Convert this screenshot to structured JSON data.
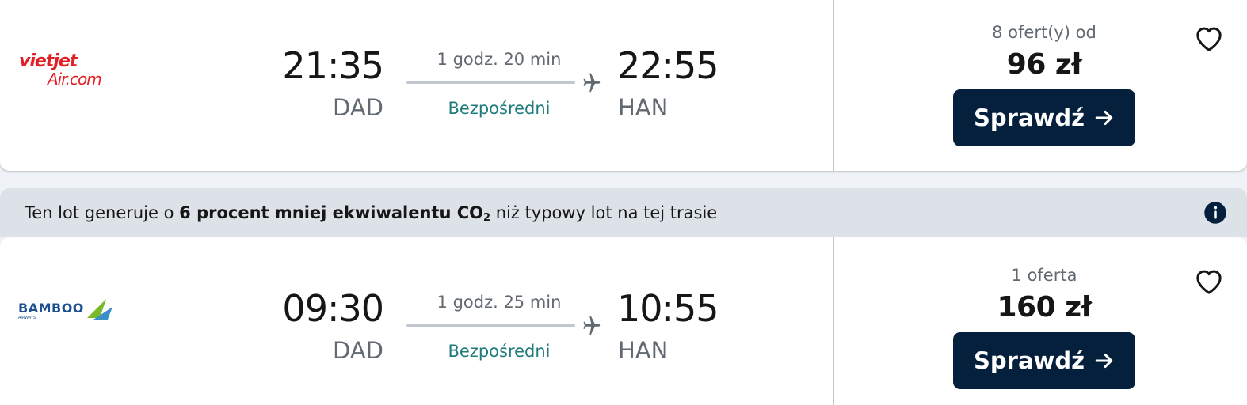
{
  "results": [
    {
      "airline": "VietJet Air",
      "logo_text_1": "vietjet",
      "logo_text_2": "Air.com",
      "dep_time": "21:35",
      "dep_code": "DAD",
      "duration": "1 godz. 20 min",
      "stops": "Bezpośredni",
      "arr_time": "22:55",
      "arr_code": "HAN",
      "offers": "8 ofert(y) od",
      "price": "96 zł",
      "button": "Sprawdź"
    },
    {
      "airline": "Bamboo Airways",
      "logo_text_1": "BAMBOO",
      "logo_text_2": "AIRWAYS",
      "dep_time": "09:30",
      "dep_code": "DAD",
      "duration": "1 godz. 25 min",
      "stops": "Bezpośredni",
      "arr_time": "10:55",
      "arr_code": "HAN",
      "offers": "1 oferta",
      "price": "160 zł",
      "button": "Sprawdź"
    }
  ],
  "eco_banner": {
    "prefix": "Ten lot generuje o ",
    "highlight": "6 procent mniej ekwiwalentu CO",
    "subscript": "2",
    "suffix": " niż typowy lot na tej trasie"
  },
  "colors": {
    "button_bg": "#05203c",
    "direct_text": "#1f7b7c",
    "vietjet_red": "#e31f26",
    "bamboo_blue": "#1c4f8f",
    "bamboo_green": "#7ab929"
  },
  "icons": {
    "plane": "plane-icon",
    "favorite": "heart-icon",
    "arrow": "arrow-right-icon",
    "info": "info-icon"
  }
}
